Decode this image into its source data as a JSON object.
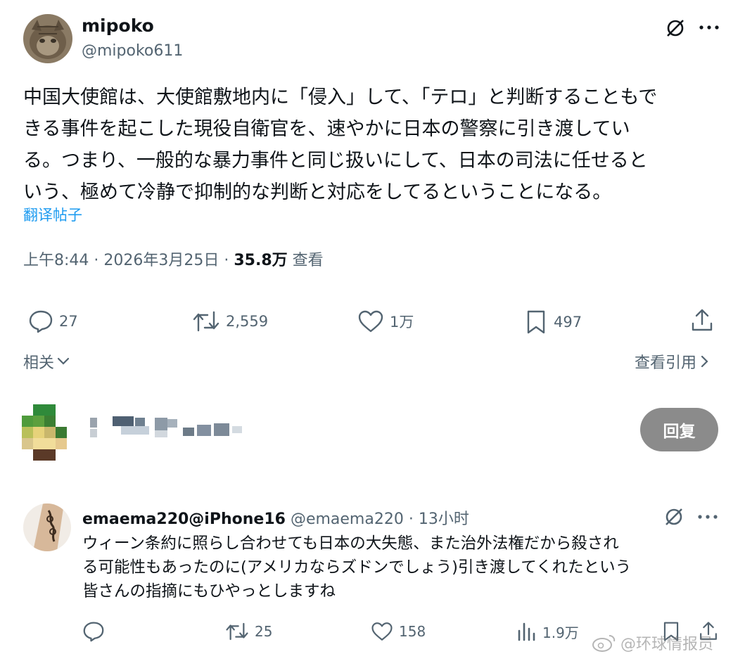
{
  "main_post": {
    "author": {
      "display_name": "mipoko",
      "handle": "@mipoko611"
    },
    "text_lines": [
      "中国大使館は、大使館敷地内に「侵入」して、「テロ」と判断することもで",
      "きる事件を起こした現役自衛官を、速やかに日本の警察に引き渡してい",
      "る。つまり、一般的な暴力事件と同じ扱いにして、日本の司法に任せると",
      "いう、極めて冷静で抑制的な判断と対応をしてるということになる。"
    ],
    "translate_link": "翻译帖子",
    "meta": {
      "time": "上午8:44",
      "sep1": " · ",
      "date": "2026年3月25日",
      "sep2": " · ",
      "views": "35.8万",
      "views_label": " 查看"
    },
    "actions": {
      "replies": "27",
      "reposts": "2,559",
      "likes": "1万",
      "bookmarks": "497"
    },
    "related_label": "相关",
    "view_quotes_label": "查看引用"
  },
  "reply_composer": {
    "reply_button": "回复"
  },
  "reply": {
    "display_name": "emaema220@iPhone16",
    "handle": "@emaema220",
    "sep": " · ",
    "time": "13小时",
    "text_lines": [
      "ウィーン条約に照らし合わせても日本の大失態、また治外法権だから殺され",
      "る可能性もあったのに(アメリカならズドンでしょう)引き渡してくれたという",
      "皆さんの指摘にもひやっとしますね"
    ],
    "actions": {
      "replies": "",
      "reposts": "25",
      "likes": "158",
      "views": "1.9万"
    }
  },
  "watermark": "@环球情报员",
  "colors": {
    "link": "#1d9bf0",
    "muted": "#536471",
    "text": "#0f1419",
    "reply_button_bg": "#8b8b8b"
  },
  "icons": [
    "grok-icon",
    "more-icon",
    "reply-icon",
    "repost-icon",
    "like-icon",
    "bookmark-icon",
    "share-icon",
    "chevron-down-icon",
    "chevron-right-icon",
    "views-icon",
    "weibo-icon"
  ]
}
